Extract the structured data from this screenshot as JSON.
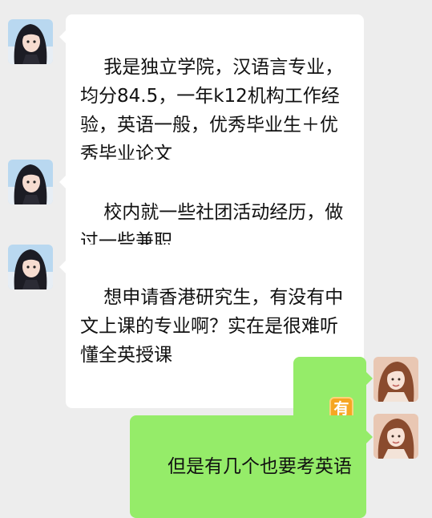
{
  "messages": [
    {
      "side": "in",
      "text": "我是独立学院，汉语言专业，均分84.5，一年k12机构工作经验，英语一般，优秀毕业生＋优秀毕业论文"
    },
    {
      "side": "in",
      "text": "校内就一些社团活动经历，做过一些兼职"
    },
    {
      "side": "in",
      "text": "想申请香港研究生，有没有中文上课的专业啊？实在是很难听懂全英授课"
    },
    {
      "side": "out",
      "text": "有",
      "icon": "you-emoji-icon"
    },
    {
      "side": "out",
      "text": "但是有几个也要考英语"
    }
  ],
  "colors": {
    "background": "#ededed",
    "incoming_bubble": "#ffffff",
    "outgoing_bubble": "#95ec69",
    "emoji_badge": "#f6a623"
  }
}
